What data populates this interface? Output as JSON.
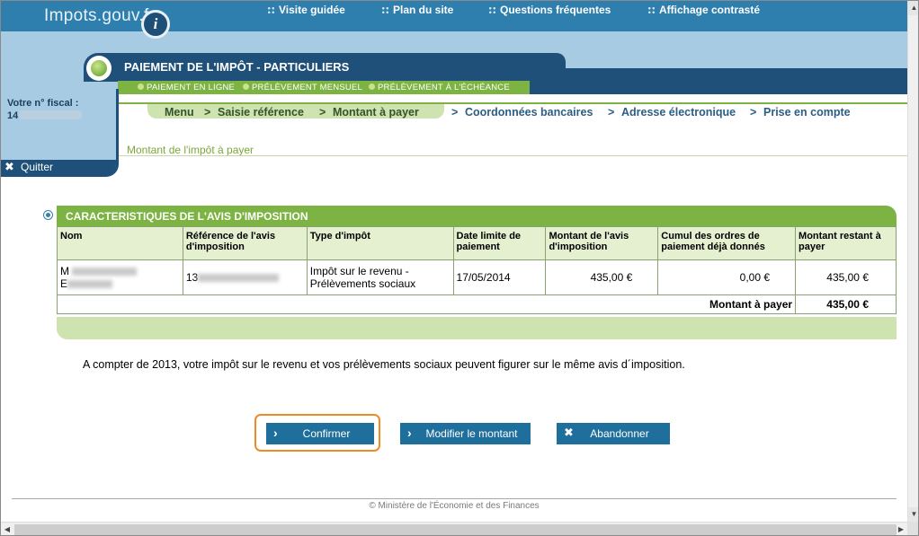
{
  "header": {
    "logo": "Impots.gouv.fr",
    "logo_badge": "i",
    "nav": [
      "Visite guidée",
      "Plan du site",
      "Questions fréquentes",
      "Affichage contrasté"
    ]
  },
  "section": {
    "title": "PAIEMENT DE L'IMPÔT - PARTICULIERS",
    "subnav": [
      "PAIEMENT EN LIGNE",
      "PRÉLÈVEMENT MENSUEL",
      "PRÉLÈVEMENT À L'ÉCHÉANCE"
    ]
  },
  "sidebar": {
    "fiscal_label": "Votre n° fiscal :",
    "fiscal_prefix": "14",
    "quit_label": "Quitter"
  },
  "breadcrumb": {
    "separator": ">",
    "done": [
      "Menu",
      "Saisie référence",
      "Montant à payer"
    ],
    "todo": [
      "Coordonnées bancaires",
      "Adresse électronique",
      "Prise en compte"
    ]
  },
  "page_subtitle": "Montant de l'impôt à payer",
  "table": {
    "title": "CARACTERISTIQUES DE L'AVIS D'IMPOSITION",
    "headers": [
      "Nom",
      "Référence de l'avis d'imposition",
      "Type d'impôt",
      "Date limite de paiement",
      "Montant de l'avis d'imposition",
      "Cumul des ordres de paiement déjà donnés",
      "Montant restant à payer"
    ],
    "row": {
      "name_line1_prefix": "M",
      "name_line2_prefix": "E",
      "reference_prefix": "13",
      "type_line1": "Impôt sur le revenu -",
      "type_line2": "Prélèvements sociaux",
      "due_date": "17/05/2014",
      "amount": "435,00 €",
      "already_paid": "0,00 €",
      "remaining": "435,00 €"
    },
    "total_label": "Montant à payer",
    "total_value": "435,00 €"
  },
  "note": "A compter de 2013, votre impôt sur le revenu et vos prélèvements sociaux peuvent figurer sur le même avis d´imposition.",
  "buttons": {
    "confirm": "Confirmer",
    "modify": "Modifier le montant",
    "cancel": "Abandonner"
  },
  "footer": "© Ministère de l'Économie et des Finances",
  "colors": {
    "dark_blue": "#1f507a",
    "header_blue": "#2f7fae",
    "light_blue": "#a6cbe3",
    "green": "#7cb342",
    "button_blue": "#1f6f9c",
    "focus_orange": "#f08a24"
  }
}
